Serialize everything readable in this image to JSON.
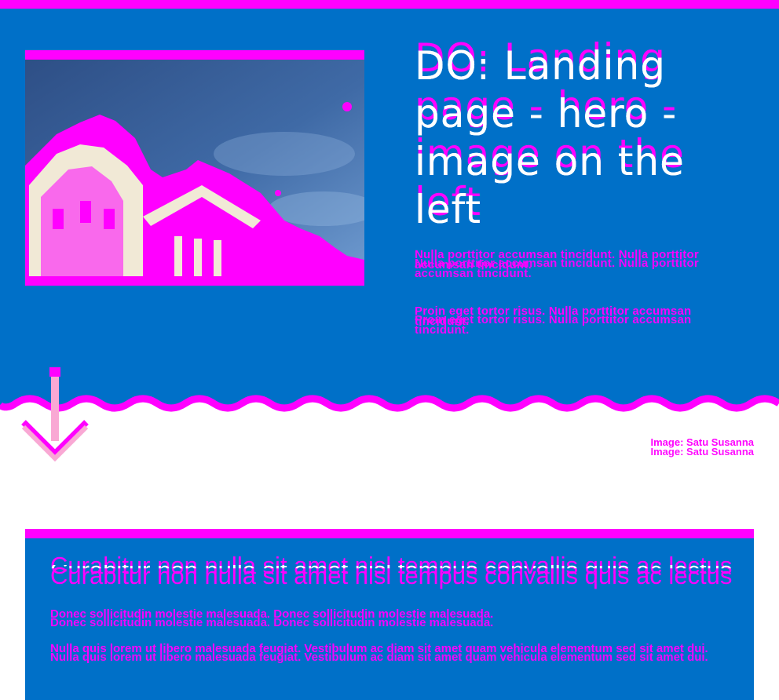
{
  "hero": {
    "title": "DO: Landing page - hero - image on the left",
    "paragraphs": [
      "Nulla porttitor accumsan tincidunt. Nulla porttitor accumsan tincidunt.",
      "Proin eget tortor risus. Nulla porttitor accumsan tincidunt."
    ],
    "photo_icon": "building-photo"
  },
  "credit": "Image: Satu Susanna",
  "scroll_icon": "scroll-down-arrow-icon",
  "card": {
    "title": "Curabitur non nulla sit amet nisl tempus convallis quis ac lectus",
    "paragraphs": [
      "Donec sollicitudin molestie malesuada. Donec sollicitudin molestie malesuada.",
      "Nulla quis lorem ut libero malesuada feugiat. Vestibulum ac diam sit amet quam vehicula elementum sed sit amet dui."
    ]
  },
  "colors": {
    "primary_blue": "#0070c8",
    "accent_magenta": "#ff00ff",
    "arrow_pink": "#f9a8d4",
    "background": "#ffffff"
  }
}
